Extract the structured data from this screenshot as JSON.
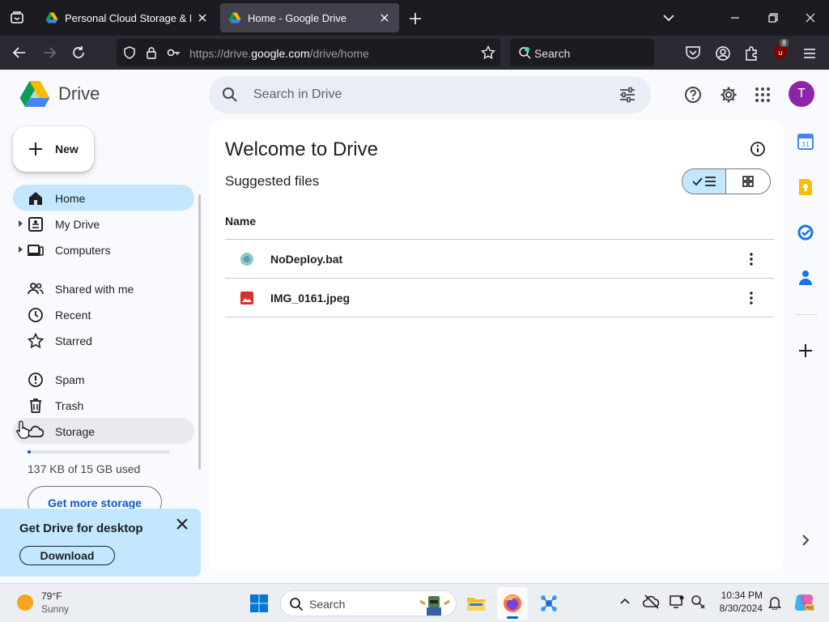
{
  "browser": {
    "tabs": [
      {
        "title": "Personal Cloud Storage & File S",
        "active": false
      },
      {
        "title": "Home - Google Drive",
        "active": true
      }
    ],
    "url_prefix": "https://drive.",
    "url_domain": "google.com",
    "url_path": "/drive/home",
    "search_label": "Search",
    "extension_badge": "8"
  },
  "drive": {
    "logo_text": "Drive",
    "search_placeholder": "Search in Drive",
    "avatar_letter": "T",
    "new_label": "New",
    "nav": [
      {
        "label": "Home",
        "icon": "home-icon",
        "selected": true
      },
      {
        "label": "My Drive",
        "icon": "my-drive-icon",
        "expandable": true
      },
      {
        "label": "Computers",
        "icon": "computers-icon",
        "expandable": true
      },
      {
        "label": "Shared with me",
        "icon": "people-icon"
      },
      {
        "label": "Recent",
        "icon": "clock-icon"
      },
      {
        "label": "Starred",
        "icon": "star-icon"
      },
      {
        "label": "Spam",
        "icon": "spam-icon"
      },
      {
        "label": "Trash",
        "icon": "trash-icon"
      },
      {
        "label": "Storage",
        "icon": "cloud-icon",
        "hover": true
      }
    ],
    "storage_used_text": "137 KB of 15 GB used",
    "storage_used_fraction": 0.01,
    "get_more_storage": "Get more storage",
    "promo": {
      "title": "Get Drive for desktop",
      "button": "Download"
    },
    "main": {
      "title": "Welcome to Drive",
      "subtitle": "Suggested files",
      "column_name": "Name",
      "view_mode": "list",
      "files": [
        {
          "name": "NoDeploy.bat",
          "icon": "generic-file-icon"
        },
        {
          "name": "IMG_0161.jpeg",
          "icon": "image-file-icon"
        }
      ]
    },
    "side_panel_apps": [
      "calendar-icon",
      "keep-icon",
      "tasks-icon",
      "contacts-icon",
      "add-icon"
    ]
  },
  "taskbar": {
    "weather_temp": "79°F",
    "weather_cond": "Sunny",
    "search_label": "Search",
    "time": "10:34 PM",
    "date": "8/30/2024"
  },
  "colors": {
    "selected_nav_bg": "#c2e7ff",
    "drive_blue": "#0b57d0",
    "avatar_bg": "#8e24aa",
    "browser_dark": "#1c1b22"
  }
}
